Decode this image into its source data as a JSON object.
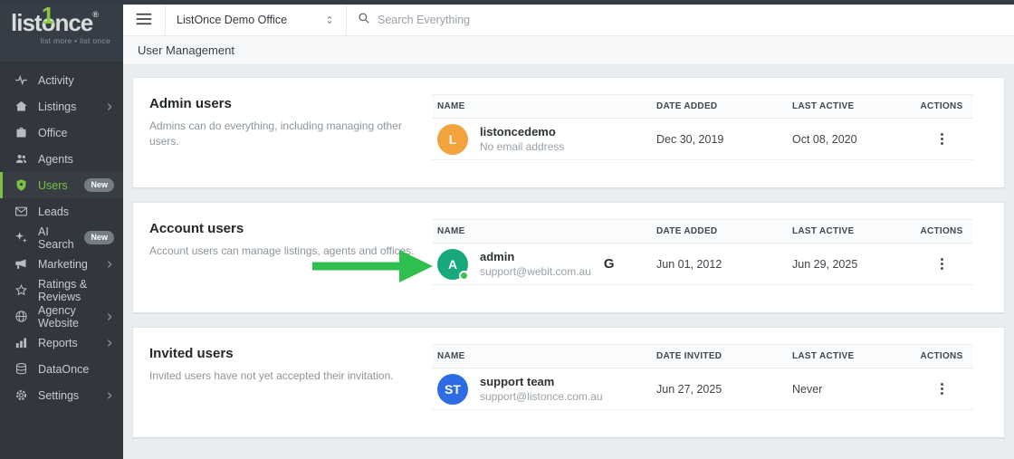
{
  "brand": {
    "logo_pre": "list",
    "logo_o": "o",
    "logo_one": "1",
    "logo_post": "nce",
    "registered": "®",
    "tagline": "list more • list once",
    "green": "#7ac143"
  },
  "topbar": {
    "office_selector": "ListOnce Demo Office",
    "search_placeholder": "Search Everything"
  },
  "page": {
    "title": "User Management"
  },
  "sidebar": {
    "items": [
      {
        "label": "Activity",
        "icon": "activity-icon"
      },
      {
        "label": "Listings",
        "icon": "listings-icon",
        "chevron": true
      },
      {
        "label": "Office",
        "icon": "office-icon"
      },
      {
        "label": "Agents",
        "icon": "agents-icon"
      },
      {
        "label": "Users",
        "icon": "users-icon",
        "badge": "New",
        "active": true
      },
      {
        "label": "Leads",
        "icon": "leads-icon"
      },
      {
        "label": "AI Search",
        "icon": "ai-search-icon",
        "badge": "New"
      },
      {
        "label": "Marketing",
        "icon": "marketing-icon",
        "chevron": true
      },
      {
        "label": "Ratings & Reviews",
        "icon": "ratings-icon"
      },
      {
        "label": "Agency Website",
        "icon": "agency-website-icon",
        "chevron": true
      },
      {
        "label": "Reports",
        "icon": "reports-icon",
        "chevron": true
      },
      {
        "label": "DataOnce",
        "icon": "dataonce-icon"
      },
      {
        "label": "Settings",
        "icon": "settings-icon",
        "chevron": true
      }
    ],
    "badge_color": "#757d84"
  },
  "sections": [
    {
      "title": "Admin users",
      "description": "Admins can do everything, including managing other users.",
      "columns": [
        "NAME",
        "DATE ADDED",
        "LAST ACTIVE",
        "ACTIONS"
      ],
      "rows": [
        {
          "avatar_initials": "L",
          "avatar_color": "#f2a33c",
          "name": "listoncedemo",
          "email": "No email address",
          "date": "Dec 30, 2019",
          "last_active": "Oct 08, 2020"
        }
      ]
    },
    {
      "title": "Account users",
      "description": "Account users can manage listings, agents and offices.",
      "columns": [
        "NAME",
        "DATE ADDED",
        "LAST ACTIVE",
        "ACTIONS"
      ],
      "rows": [
        {
          "avatar_initials": "A",
          "avatar_color": "#17a97c",
          "name": "admin",
          "email": "support@webit.com.au",
          "google_badge": "G",
          "online": true,
          "date": "Jun 01, 2012",
          "last_active": "Jun 29, 2025"
        }
      ]
    },
    {
      "title": "Invited users",
      "description": "Invited users have not yet accepted their invitation.",
      "columns": [
        "NAME",
        "DATE INVITED",
        "LAST ACTIVE",
        "ACTIONS"
      ],
      "rows": [
        {
          "avatar_initials": "ST",
          "avatar_color": "#2d6ce5",
          "name": "support team",
          "email": "support@listonce.com.au",
          "date": "Jun 27, 2025",
          "last_active": "Never"
        }
      ]
    }
  ],
  "annotation": {
    "type": "arrow-right",
    "color": "#2fbf4e"
  }
}
